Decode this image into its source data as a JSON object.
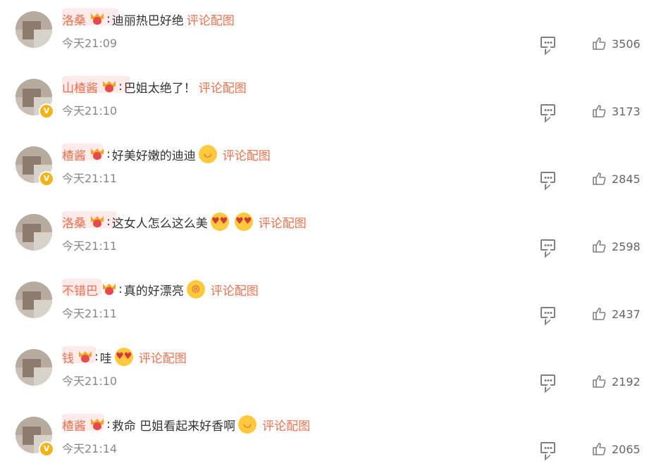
{
  "labels": {
    "pic_link": "评论配图"
  },
  "comments": [
    {
      "name_visible": "洛桑",
      "text": "迪丽热巴好绝",
      "emojis": [],
      "time": "今天21:09",
      "likes": "3506",
      "verified": false
    },
    {
      "name_visible": "山楂酱",
      "text": "巴姐太绝了！",
      "emojis": [],
      "time": "今天21:10",
      "likes": "3173",
      "verified": true
    },
    {
      "name_visible": "楂酱",
      "text": "好美好嫩的迪迪",
      "emojis": [
        "yummy-emoji"
      ],
      "time": "今天21:11",
      "likes": "2845",
      "verified": true
    },
    {
      "name_visible": "洛桑",
      "text": "这女人怎么这么美",
      "emojis": [
        "heart-eyes-emoji",
        "heart-eyes-emoji"
      ],
      "time": "今天21:11",
      "likes": "2598",
      "verified": false
    },
    {
      "name_visible": "不错巴",
      "text": "真的好漂亮",
      "emojis": [
        "shocked-emoji"
      ],
      "time": "今天21:11",
      "likes": "2437",
      "verified": false
    },
    {
      "name_visible": "钱",
      "text": "哇",
      "emojis": [
        "heart-eyes-emoji"
      ],
      "time": "今天21:10",
      "likes": "2192",
      "verified": false
    },
    {
      "name_visible": "楂酱",
      "text": "救命 巴姐看起来好香啊",
      "emojis": [
        "yummy-emoji"
      ],
      "time": "今天21:14",
      "likes": "2065",
      "verified": true
    }
  ],
  "colors": {
    "accent": "#eb7350",
    "text": "#333333",
    "muted": "#888888",
    "badge": "#f3b418"
  }
}
